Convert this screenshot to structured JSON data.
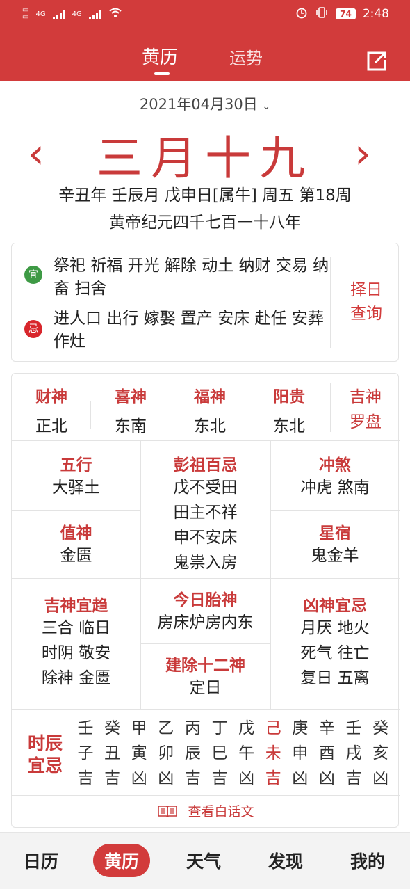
{
  "colors": {
    "brand": "#d23b3b",
    "accent_text": "#c93a3a",
    "yi_badge": "#3e9a45",
    "ji_badge": "#d8262c"
  },
  "status": {
    "net1": "4G",
    "net2": "4G",
    "battery": "74",
    "time": "2:48"
  },
  "header": {
    "tab_active": "黄历",
    "tab_inactive": "运势",
    "share_icon": "share-icon"
  },
  "date": {
    "selector": "2021年04月30日",
    "lunar": "三月十九",
    "line1": "辛丑年 壬辰月 戊申日[属牛] 周五 第18周",
    "line2": "黄帝纪元四千七百一十八年"
  },
  "yiji": {
    "yi_badge": "宜",
    "yi_text": "祭祀 祈福 开光 解除 动土 纳财 交易 纳畜 扫舍",
    "ji_badge": "忌",
    "ji_text": "进人口 出行 嫁娶 置产 安床 赴任 安葬 作灶",
    "zeri_line1": "择日",
    "zeri_line2": "查询"
  },
  "gods": [
    {
      "name": "财神",
      "dir": "正北"
    },
    {
      "name": "喜神",
      "dir": "东南"
    },
    {
      "name": "福神",
      "dir": "东北"
    },
    {
      "name": "阳贵",
      "dir": "东北"
    }
  ],
  "luopan": {
    "line1": "吉神",
    "line2": "罗盘"
  },
  "info": {
    "wuxing": {
      "title": "五行",
      "value": "大驿土"
    },
    "zhishen": {
      "title": "值神",
      "value": "金匮"
    },
    "pengzu": {
      "title": "彭祖百忌",
      "lines": [
        "戊不受田",
        "田主不祥",
        "申不安床",
        "鬼祟入房"
      ]
    },
    "chongsha": {
      "title": "冲煞",
      "value": "冲虎 煞南"
    },
    "xingsu": {
      "title": "星宿",
      "value": "鬼金羊"
    },
    "jishen": {
      "title": "吉神宜趋",
      "lines": [
        "三合 临日",
        "时阴 敬安",
        "除神 金匮"
      ]
    },
    "taishen": {
      "title": "今日胎神",
      "value": "房床炉房内东"
    },
    "jianchu": {
      "title": "建除十二神",
      "value": "定日"
    },
    "xiongshen": {
      "title": "凶神宜忌",
      "lines": [
        "月厌 地火",
        "死气 往亡",
        "复日 五离"
      ]
    }
  },
  "hours": {
    "title_line1": "时辰",
    "title_line2": "宜忌",
    "columns": [
      {
        "stem": "壬",
        "branch": "子",
        "luck": "吉"
      },
      {
        "stem": "癸",
        "branch": "丑",
        "luck": "吉"
      },
      {
        "stem": "甲",
        "branch": "寅",
        "luck": "凶"
      },
      {
        "stem": "乙",
        "branch": "卯",
        "luck": "凶"
      },
      {
        "stem": "丙",
        "branch": "辰",
        "luck": "吉"
      },
      {
        "stem": "丁",
        "branch": "巳",
        "luck": "吉"
      },
      {
        "stem": "戊",
        "branch": "午",
        "luck": "凶"
      },
      {
        "stem": "己",
        "branch": "未",
        "luck": "吉"
      },
      {
        "stem": "庚",
        "branch": "申",
        "luck": "凶"
      },
      {
        "stem": "辛",
        "branch": "酉",
        "luck": "凶"
      },
      {
        "stem": "壬",
        "branch": "戌",
        "luck": "吉"
      },
      {
        "stem": "癸",
        "branch": "亥",
        "luck": "凶"
      }
    ]
  },
  "baihua": "查看白话文",
  "nav": [
    "日历",
    "黄历",
    "天气",
    "发现",
    "我的"
  ]
}
